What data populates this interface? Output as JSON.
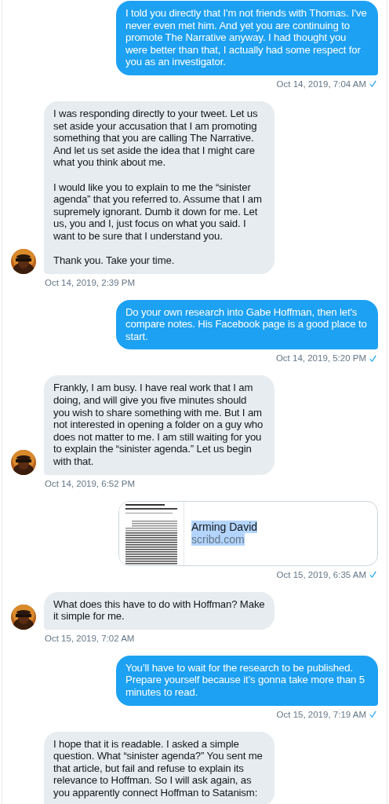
{
  "messages": [
    {
      "kind": "text",
      "outgoing": true,
      "text": "I told you directly that I'm not friends with Thomas. I've never even met him. And yet you are continuing to promote The Narrative anyway. I had thought you were better than that, I actually had some respect for you as an investigator.",
      "timestamp": "Oct 14, 2019, 7:04 AM",
      "read": true
    },
    {
      "kind": "text",
      "outgoing": false,
      "avatar": true,
      "text": "I was responding directly to your tweet. Let us set aside your accusation that I am promoting something that you are calling The Narrative. And let us set aside the idea that I might care what you think about me.\n\nI would like you to explain to me the “sinister agenda” that you referred to. Assume that I am supremely ignorant. Dumb it down for me. Let us, you and I, just focus on what you said. I want to be sure that I understand you.\n\nThank you. Take your time.",
      "timestamp": "Oct 14, 2019, 2:39 PM"
    },
    {
      "kind": "text",
      "outgoing": true,
      "text": "Do your own research into Gabe Hoffman, then let's compare notes. His Facebook page is a good place to start.",
      "timestamp": "Oct 14, 2019, 5:20 PM",
      "read": true
    },
    {
      "kind": "text",
      "outgoing": false,
      "avatar": true,
      "text": "Frankly, I am busy. I have real work that I am doing, and will give you five minutes should you wish to share something with me. But I am not interested in opening a folder on a guy who does not matter to me. I am still waiting for you to explain the “sinister agenda.” Let us begin with that.",
      "timestamp": "Oct 14, 2019, 6:52 PM"
    },
    {
      "kind": "link",
      "outgoing": true,
      "title": "Arming David",
      "domain": "scribd.com",
      "text_highlighted": true,
      "timestamp": "Oct 15, 2019, 6:35 AM",
      "read": true
    },
    {
      "kind": "text",
      "outgoing": false,
      "avatar": true,
      "text": "What does this have to do with Hoffman? Make it simple for me.",
      "timestamp": "Oct 15, 2019, 7:02 AM"
    },
    {
      "kind": "text",
      "outgoing": true,
      "text": "You’ll have to wait for the research to be published. Prepare yourself because it’s gonna take more than 5 minutes to read.",
      "timestamp": "Oct 15, 2019, 7:19 AM",
      "read": true
    },
    {
      "kind": "text",
      "outgoing": false,
      "avatar": false,
      "text": "I hope that it is readable. I asked a simple question. What “sinister agenda?” You sent me that article, but fail and refuse to explain its relevance to Hoffman. So I will ask again, as you apparently connect Hoffman to Satanism:"
    }
  ]
}
